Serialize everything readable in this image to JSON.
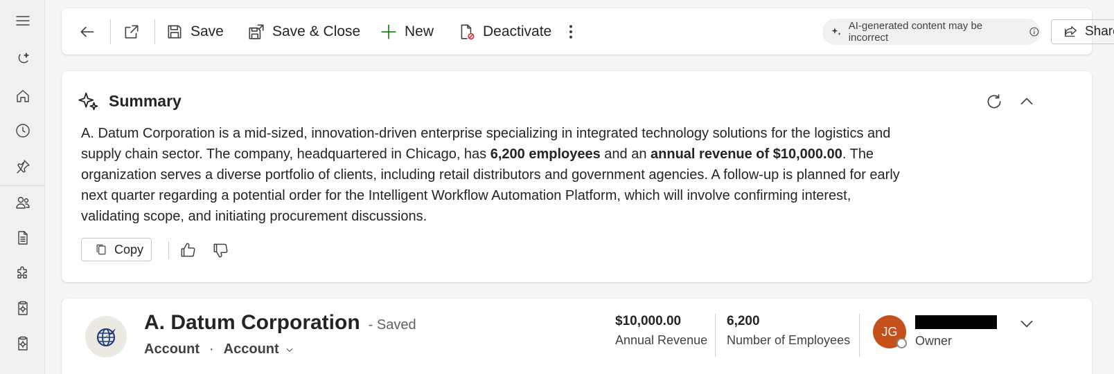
{
  "rail": {
    "items": [
      {
        "icon": "hamburger-icon"
      },
      {
        "icon": "copilot-icon"
      },
      {
        "icon": "home-icon"
      },
      {
        "icon": "clock-icon"
      },
      {
        "icon": "pin-icon"
      },
      {
        "icon": "people-icon"
      },
      {
        "icon": "document-icon"
      },
      {
        "icon": "puzzle-icon"
      },
      {
        "icon": "clipboard-gear-icon"
      },
      {
        "icon": "clipboard-gear-icon"
      }
    ]
  },
  "toolbar": {
    "save_label": "Save",
    "save_close_label": "Save & Close",
    "new_label": "New",
    "deactivate_label": "Deactivate",
    "ai_notice": "AI-generated content may be incorrect",
    "share_label": "Share"
  },
  "summary": {
    "title": "Summary",
    "text_1": "A. Datum Corporation is a mid-sized, innovation-driven enterprise specializing in integrated technology solutions for the logistics and supply chain sector. The company, headquartered in Chicago, has ",
    "bold_1": "6,200 employees",
    "text_2": " and an ",
    "bold_2": "annual revenue of $10,000.00",
    "text_3": ". The organization serves a diverse portfolio of clients, including retail distributors and government agencies. A follow-up is planned for early next quarter regarding a potential order for the Intelligent Workflow Automation Platform, which will involve confirming interest, validating scope, and initiating procurement discussions.",
    "copy_label": "Copy"
  },
  "record": {
    "name": "A. Datum Corporation",
    "status": "- Saved",
    "entity": "Account",
    "separator": "·",
    "form": "Account",
    "annual_revenue_value": "$10,000.00",
    "annual_revenue_label": "Annual Revenue",
    "employees_value": "6,200",
    "employees_label": "Number of Employees",
    "owner_initials": "JG",
    "owner_label": "Owner"
  },
  "colors": {
    "accent_green": "#107c10",
    "owner_avatar": "#c4501b",
    "deactivate_badge": "#d13438"
  }
}
